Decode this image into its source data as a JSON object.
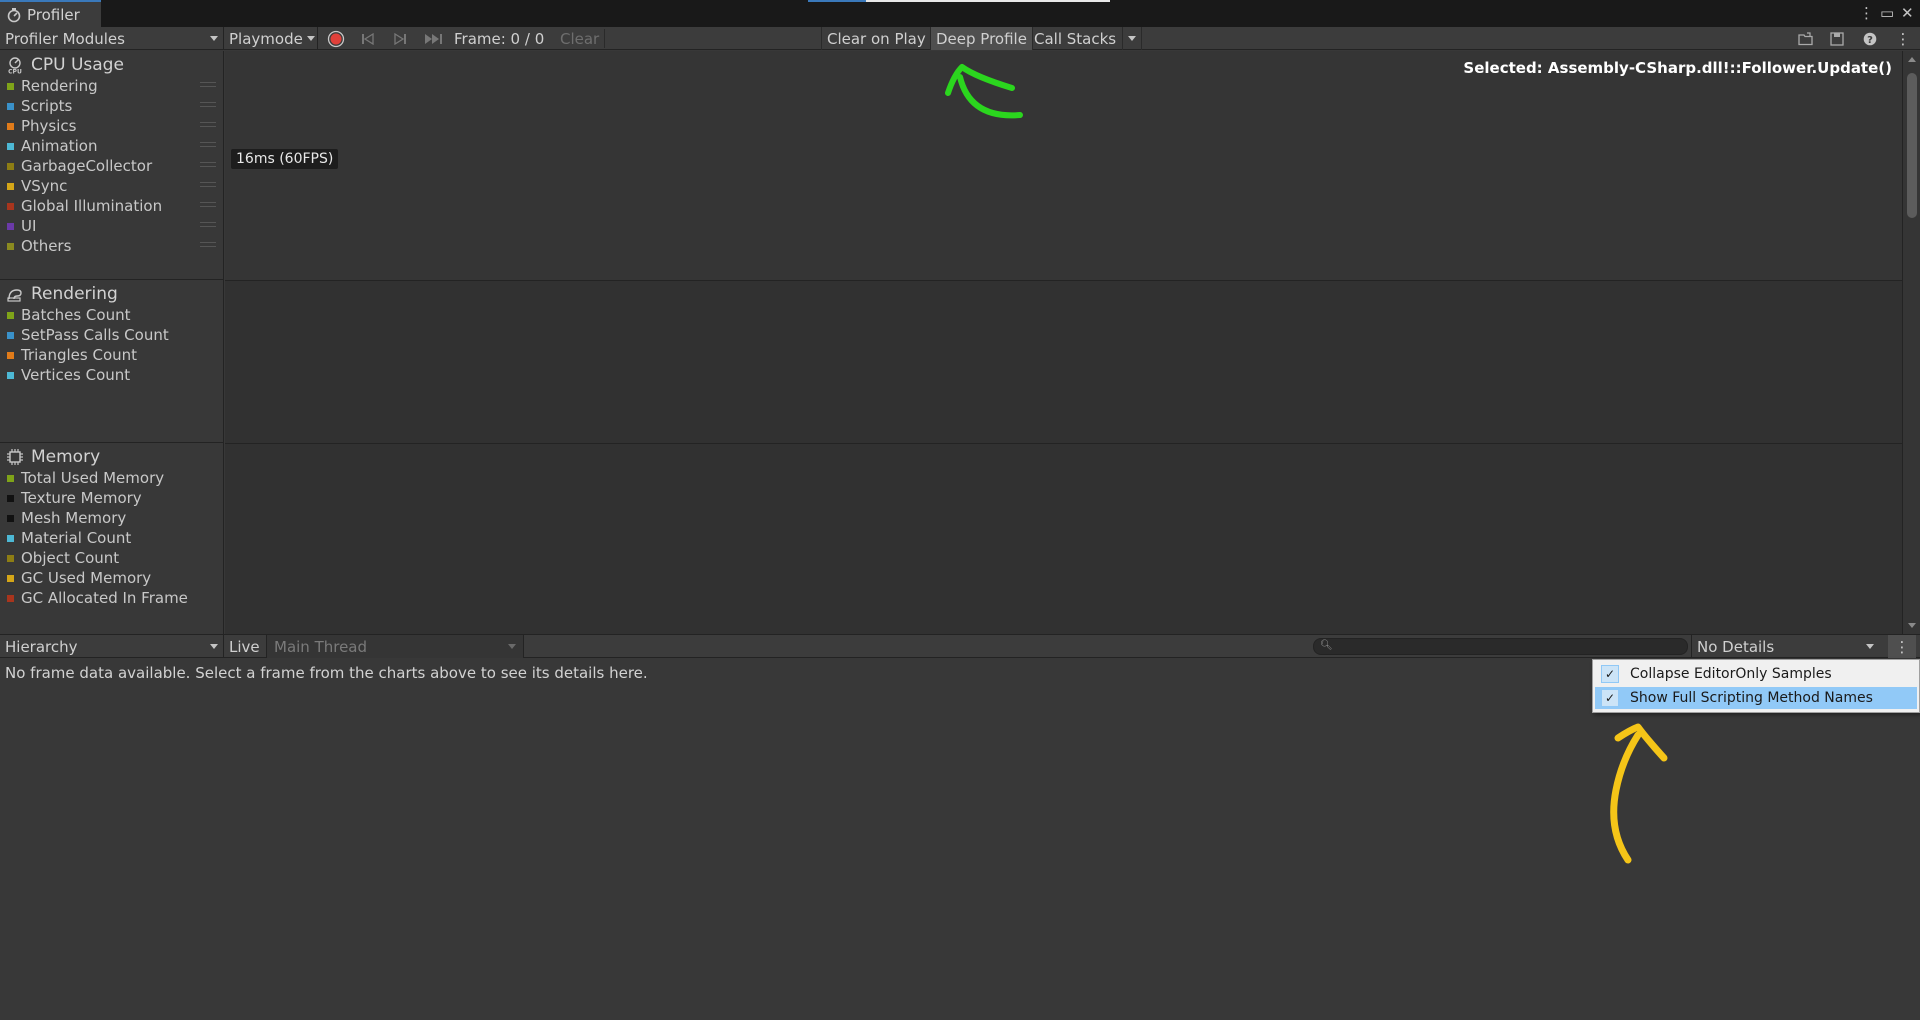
{
  "window": {
    "tab_title": "Profiler",
    "controls": [
      "⋮",
      "▭",
      "✕"
    ]
  },
  "toolbar": {
    "modules_dropdown": "Profiler Modules",
    "target_dropdown": "Playmode",
    "frame_label": "Frame: 0 / 0",
    "clear": "Clear",
    "clear_on_play": "Clear on Play",
    "deep_profile": "Deep Profile",
    "call_stacks": "Call Stacks"
  },
  "modules": [
    {
      "title": "CPU Usage",
      "icon": "cpu-icon",
      "items": [
        {
          "label": "Rendering",
          "color": "#7fa319"
        },
        {
          "label": "Scripts",
          "color": "#3a91c9"
        },
        {
          "label": "Physics",
          "color": "#e07b1a"
        },
        {
          "label": "Animation",
          "color": "#4db8d4"
        },
        {
          "label": "GarbageCollector",
          "color": "#8d7d14"
        },
        {
          "label": "VSync",
          "color": "#d4a618"
        },
        {
          "label": "Global Illumination",
          "color": "#a8351d"
        },
        {
          "label": "UI",
          "color": "#6b3aa8"
        },
        {
          "label": "Others",
          "color": "#8a8a20"
        }
      ]
    },
    {
      "title": "Rendering",
      "icon": "rendering-icon",
      "items": [
        {
          "label": "Batches Count",
          "color": "#7fa319"
        },
        {
          "label": "SetPass Calls Count",
          "color": "#3a91c9"
        },
        {
          "label": "Triangles Count",
          "color": "#e07b1a"
        },
        {
          "label": "Vertices Count",
          "color": "#4db8d4"
        }
      ]
    },
    {
      "title": "Memory",
      "icon": "memory-chip-icon",
      "items": [
        {
          "label": "Total Used Memory",
          "color": "#7fa319"
        },
        {
          "label": "Texture Memory",
          "color": "#111111"
        },
        {
          "label": "Mesh Memory",
          "color": "#111111"
        },
        {
          "label": "Material Count",
          "color": "#4db8d4"
        },
        {
          "label": "Object Count",
          "color": "#8d7d14"
        },
        {
          "label": "GC Used Memory",
          "color": "#d4a618"
        },
        {
          "label": "GC Allocated In Frame",
          "color": "#a8351d"
        }
      ]
    }
  ],
  "chart": {
    "selected": "Selected: Assembly-CSharp.dll!::Follower.Update()",
    "fps_marker": "16ms (60FPS)"
  },
  "details": {
    "view_dropdown": "Hierarchy",
    "live": "Live",
    "thread_dropdown": "Main Thread",
    "search_placeholder": "",
    "details_dropdown": "No Details",
    "empty_message": "No frame data available. Select a frame from the charts above to see its details here."
  },
  "context_menu": {
    "items": [
      {
        "label": "Collapse EditorOnly Samples",
        "checked": true
      },
      {
        "label": "Show Full Scripting Method Names",
        "checked": true,
        "highlighted": true
      }
    ]
  }
}
